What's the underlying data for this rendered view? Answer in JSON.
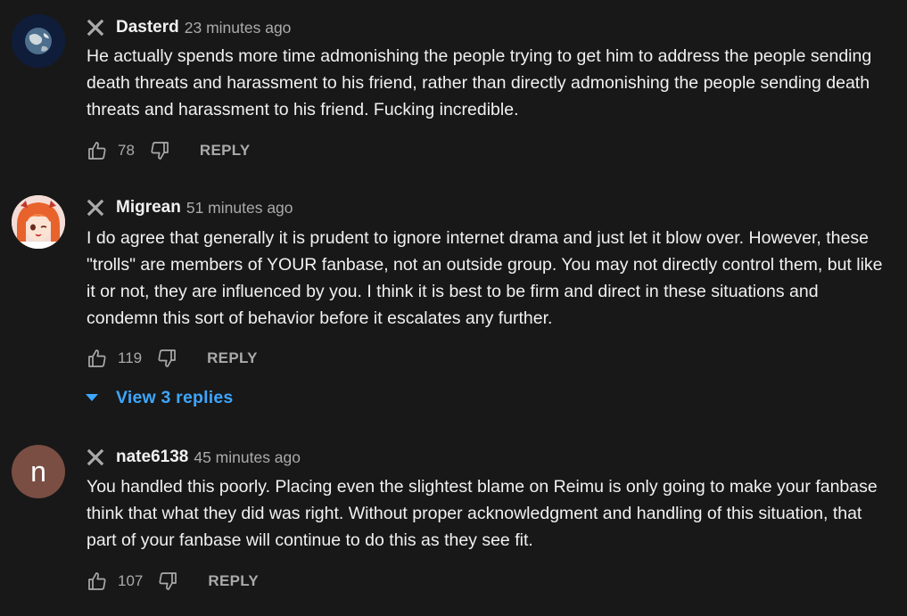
{
  "comments": [
    {
      "author": "Dasterd",
      "time": "23 minutes ago",
      "text": "He actually spends more time admonishing the people trying to get him to address the people sending death threats and harassment to his friend, rather than directly admonishing the people sending death threats and harassment to his friend. Fucking incredible.",
      "likes": "78",
      "reply_label": "REPLY",
      "avatar_icon": "earth-globe-avatar"
    },
    {
      "author": "Migrean",
      "time": "51 minutes ago",
      "text": "I do agree that generally it is prudent to ignore internet drama and just let it blow over. However, these \"trolls\" are members of YOUR fanbase, not an outside group. You may not directly control them, but like it or not, they are influenced by you. I think it is best to be firm and direct in these situations and condemn this sort of behavior before it escalates any further.",
      "likes": "119",
      "reply_label": "REPLY",
      "view_replies_label": "View 3 replies",
      "avatar_icon": "anime-character-avatar"
    },
    {
      "author": "nate6138",
      "time": "45 minutes ago",
      "text": "You handled this poorly. Placing even the slightest blame on Reimu is only going to make your fanbase think that what they did was right. Without proper acknowledgment and handling of this situation, that part of your fanbase will continue to do this as they see fit.",
      "likes": "107",
      "reply_label": "REPLY",
      "avatar_letter": "n",
      "avatar_color": "#7a4e43"
    }
  ],
  "colors": {
    "background": "#181818",
    "text": "#f1f1f1",
    "secondary_text": "#aaaaaa",
    "link": "#3ea6ff"
  }
}
